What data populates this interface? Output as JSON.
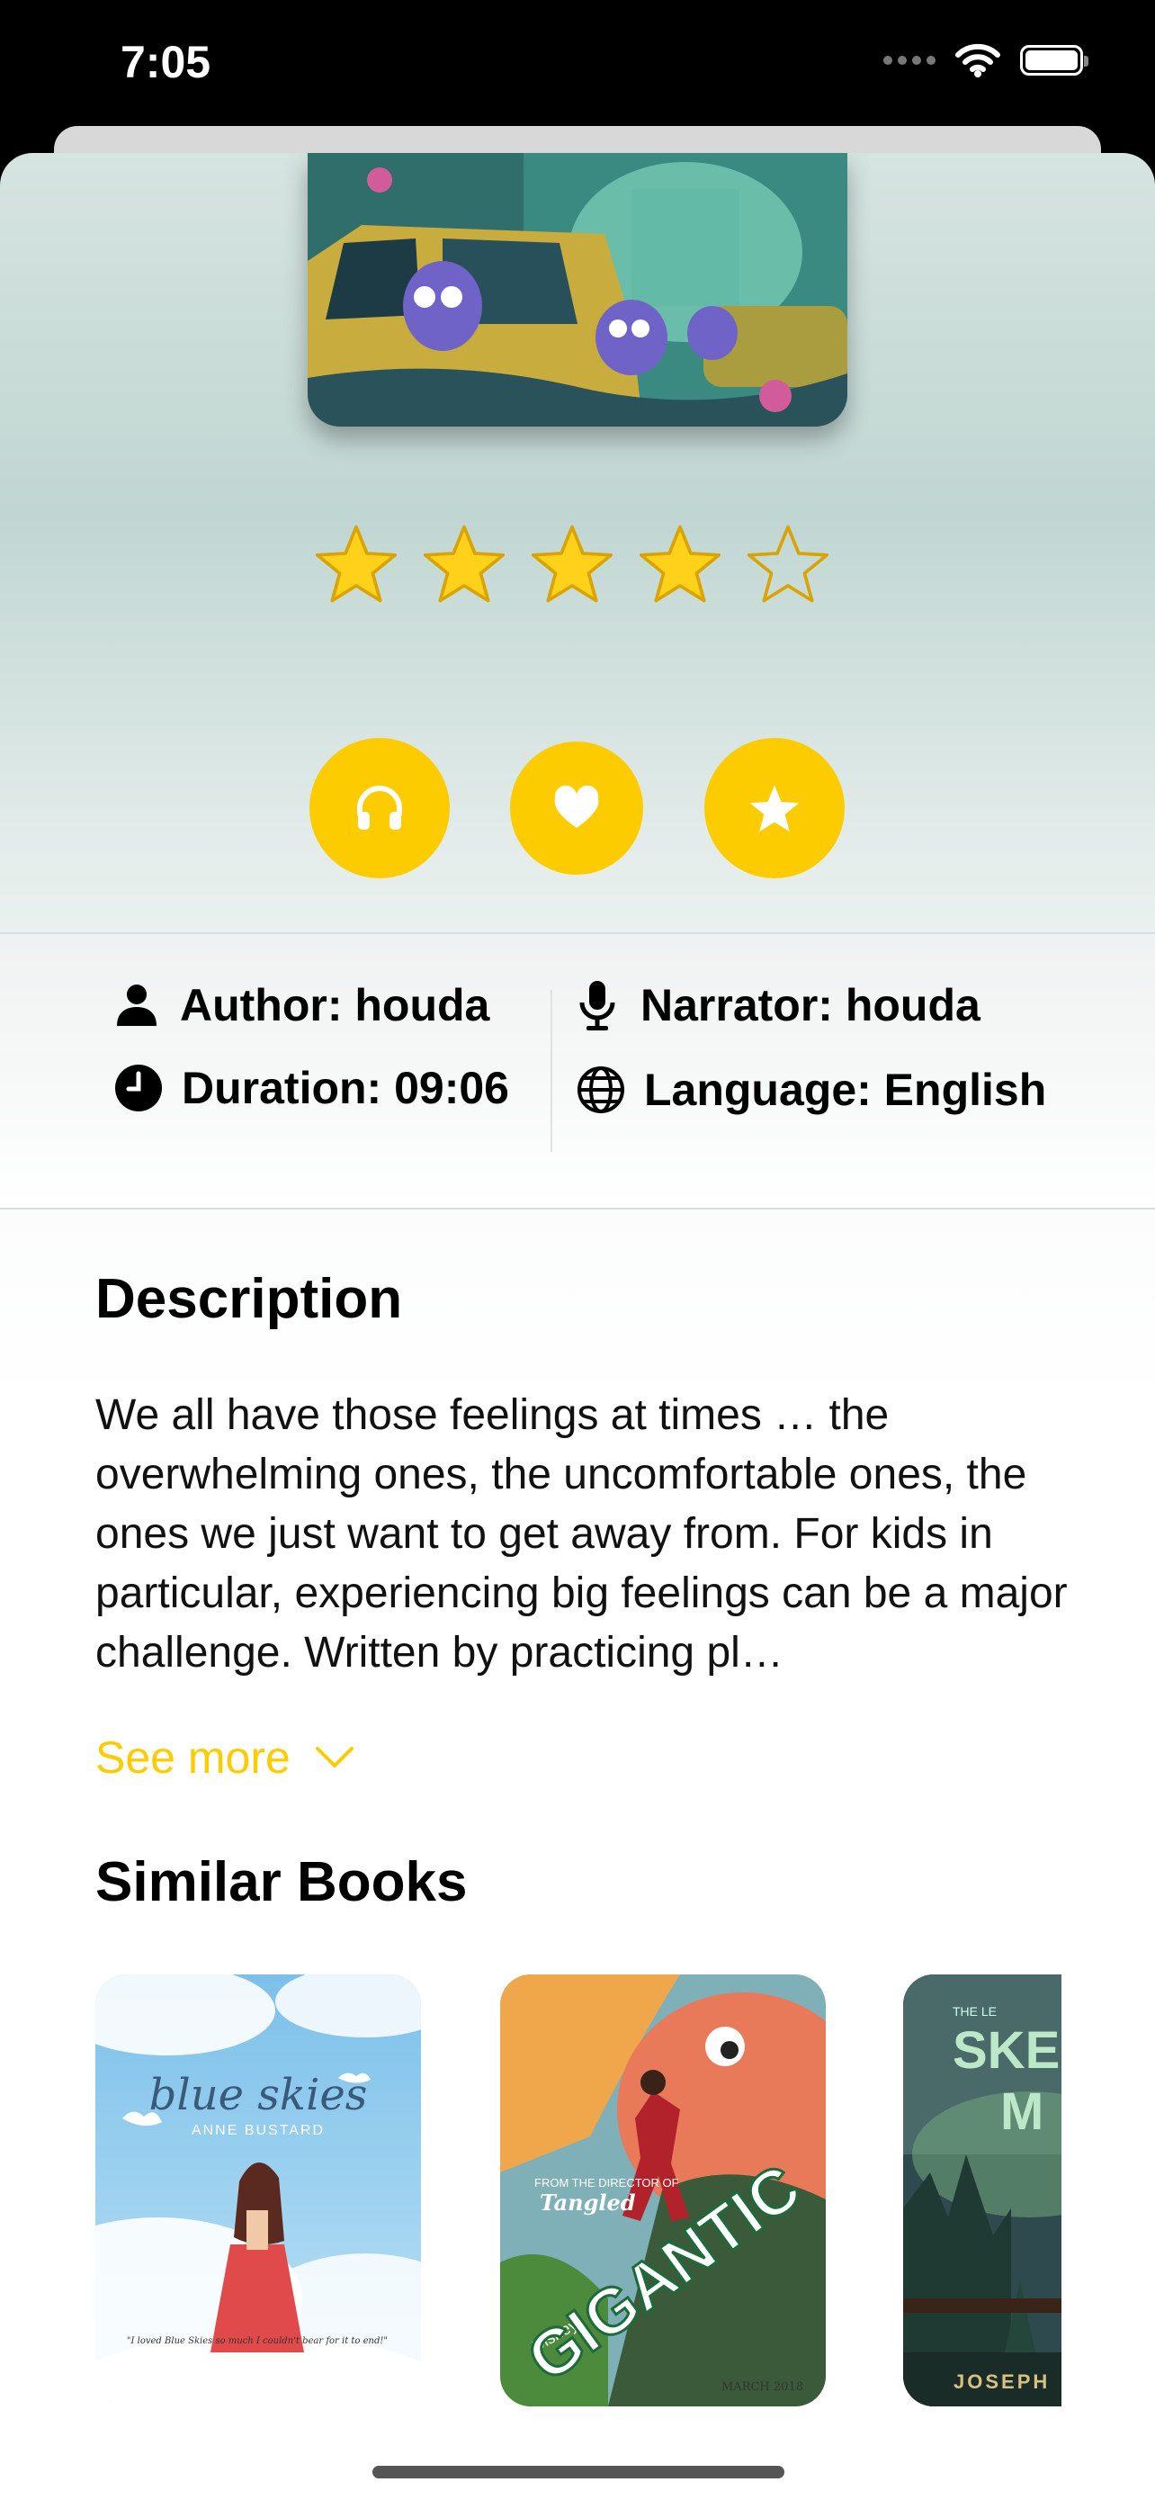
{
  "status_bar": {
    "time": "7:05"
  },
  "colors": {
    "accent": "#fdcc00",
    "background": "#ffffff",
    "text": "#000000"
  },
  "rating": {
    "value": 4,
    "max": 5
  },
  "actions": [
    {
      "name": "listen",
      "icon": "headphones-icon"
    },
    {
      "name": "favorite",
      "icon": "heart-icon"
    },
    {
      "name": "rate",
      "icon": "star-icon"
    }
  ],
  "info": {
    "author": "Author: houda",
    "narrator": "Narrator: houda",
    "duration": "Duration: 09:06",
    "language": "Language: English"
  },
  "description": {
    "title": "Description",
    "text": "We all have those feelings at times … the overwhelming ones, the uncomfortable ones, the ones we just want to get away from. For kids in particular, experiencing big feelings can be a major challenge. Written by practicing pl…",
    "see_more": "See more"
  },
  "similar": {
    "title": "Similar Books",
    "books": [
      {
        "title": "blue skies",
        "author": "ANNE BUSTARD",
        "quote": "\"I loved Blue Skies so much I couldn't bear for it to end!\""
      },
      {
        "title": "GIGANTIC",
        "tagline": "FROM THE DIRECTOR OF",
        "film": "Tangled",
        "brand": "Disney",
        "date": "MARCH 2018"
      },
      {
        "title": "SKEL",
        "title2": "M",
        "prefix": "THE LE",
        "author": "JOSEPH"
      }
    ]
  }
}
